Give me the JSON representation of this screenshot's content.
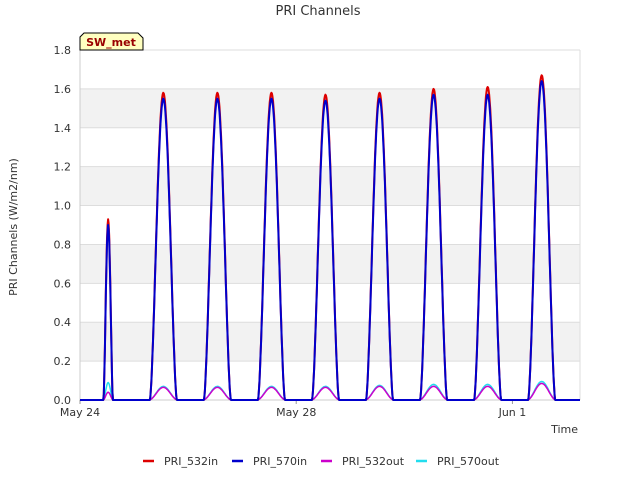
{
  "chart_data": {
    "type": "line",
    "title": "PRI Channels",
    "xlabel": "Time",
    "ylabel": "PRI Channels (W/m2/nm)",
    "ylim": [
      0,
      1.8
    ],
    "xlim": [
      "2024-05-24T00:00",
      "2024-06-02T06:00"
    ],
    "y_ticks": [
      "0.0",
      "0.2",
      "0.4",
      "0.6",
      "0.8",
      "1.0",
      "1.2",
      "1.4",
      "1.6",
      "1.8"
    ],
    "x_ticks": [
      {
        "label": "May 24",
        "x": "2024-05-24T00:00"
      },
      {
        "label": "May 28",
        "x": "2024-05-28T00:00"
      },
      {
        "label": "Jun 1",
        "x": "2024-06-01T00:00"
      }
    ],
    "grid": true,
    "legend_position": "bottom",
    "annotation": "SW_met",
    "daily_peaks": [
      {
        "noon": "2024-05-24T12:30",
        "PRI_532in": 0.93,
        "PRI_570in": 0.9,
        "PRI_532out": 0.04,
        "PRI_570out": 0.09
      },
      {
        "noon": "2024-05-25T13:00",
        "PRI_532in": 1.58,
        "PRI_570in": 1.55,
        "PRI_532out": 0.065,
        "PRI_570out": 0.07
      },
      {
        "noon": "2024-05-26T13:00",
        "PRI_532in": 1.58,
        "PRI_570in": 1.55,
        "PRI_532out": 0.065,
        "PRI_570out": 0.07
      },
      {
        "noon": "2024-05-27T13:00",
        "PRI_532in": 1.58,
        "PRI_570in": 1.55,
        "PRI_532out": 0.065,
        "PRI_570out": 0.07
      },
      {
        "noon": "2024-05-28T13:00",
        "PRI_532in": 1.57,
        "PRI_570in": 1.54,
        "PRI_532out": 0.065,
        "PRI_570out": 0.07
      },
      {
        "noon": "2024-05-29T13:00",
        "PRI_532in": 1.58,
        "PRI_570in": 1.55,
        "PRI_532out": 0.07,
        "PRI_570out": 0.075
      },
      {
        "noon": "2024-05-30T13:00",
        "PRI_532in": 1.6,
        "PRI_570in": 1.57,
        "PRI_532out": 0.07,
        "PRI_570out": 0.08
      },
      {
        "noon": "2024-05-31T13:00",
        "PRI_532in": 1.61,
        "PRI_570in": 1.57,
        "PRI_532out": 0.07,
        "PRI_570out": 0.08
      },
      {
        "noon": "2024-06-01T13:00",
        "PRI_532in": 1.67,
        "PRI_570in": 1.64,
        "PRI_532out": 0.085,
        "PRI_570out": 0.095
      }
    ],
    "series": [
      {
        "name": "PRI_532in",
        "color": "#dd0000",
        "width": 2
      },
      {
        "name": "PRI_570in",
        "color": "#0000cc",
        "width": 2
      },
      {
        "name": "PRI_532out",
        "color": "#cc00cc",
        "width": 1.5
      },
      {
        "name": "PRI_570out",
        "color": "#22ddee",
        "width": 1.5
      }
    ]
  }
}
